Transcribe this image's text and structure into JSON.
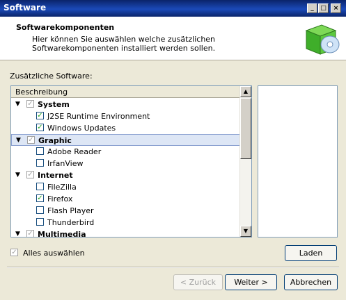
{
  "window": {
    "title": "Software"
  },
  "header": {
    "title": "Softwarekomponenten",
    "description": "Hier können Sie auswählen welche zusätzlichen Softwarekomponenten installiert werden sollen."
  },
  "section_label": "Zusätzliche Software:",
  "tree": {
    "column_header": "Beschreibung",
    "rows": [
      {
        "label": "System",
        "group": true,
        "checked": true
      },
      {
        "label": "J2SE Runtime Environment",
        "checked": true
      },
      {
        "label": "Windows Updates",
        "checked": true
      },
      {
        "label": "Graphic",
        "group": true,
        "checked": true,
        "selected": true
      },
      {
        "label": "Adobe Reader",
        "checked": false
      },
      {
        "label": "IrfanView",
        "checked": false
      },
      {
        "label": "Internet",
        "group": true,
        "checked": true
      },
      {
        "label": "FileZilla",
        "checked": false
      },
      {
        "label": "Firefox",
        "checked": true
      },
      {
        "label": "Flash Player",
        "checked": false
      },
      {
        "label": "Thunderbird",
        "checked": false
      },
      {
        "label": "Multimedia",
        "group": true,
        "checked": true
      }
    ]
  },
  "select_all": {
    "label": "Alles auswählen",
    "checked": true
  },
  "buttons": {
    "laden": "Laden",
    "back": "< Zurück",
    "next": "Weiter >",
    "cancel": "Abbrechen"
  }
}
